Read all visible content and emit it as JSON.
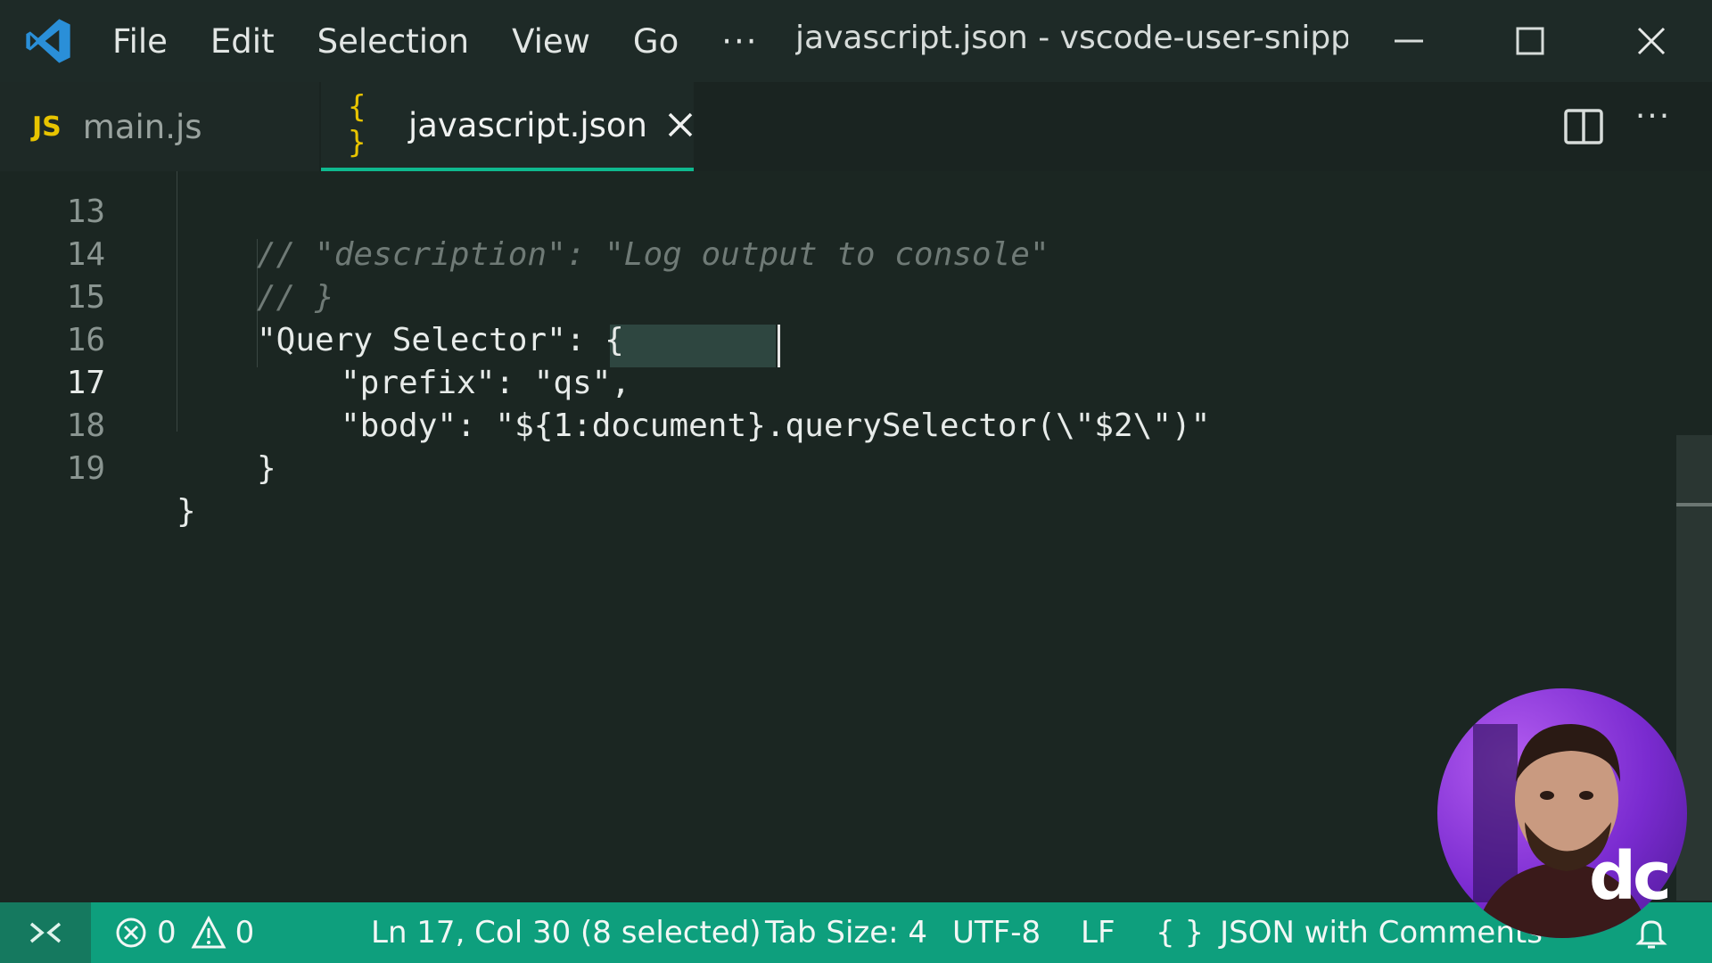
{
  "titlebar": {
    "menu": [
      "File",
      "Edit",
      "Selection",
      "View",
      "Go"
    ],
    "more_label": "···",
    "window_title": "javascript.json - vscode-user-snippet..."
  },
  "tabs": [
    {
      "badge": "JS",
      "label": "main.js",
      "active": false
    },
    {
      "badge": "{ }",
      "label": "javascript.json",
      "active": true
    }
  ],
  "editor_actions": {
    "more_label": "···"
  },
  "editor": {
    "lines": [
      {
        "number": "13",
        "text": "// \"description\": \"Log output to console\""
      },
      {
        "number": "14",
        "text": "// }"
      },
      {
        "number": "15",
        "text": "\"Query Selector\": {"
      },
      {
        "number": "16",
        "text": "\"prefix\": \"qs\","
      },
      {
        "number": "17",
        "before_selection": "\"body\": \"${1:",
        "selection": "document",
        "after_selection": "}.querySelector(\\\"$2\\\")\""
      },
      {
        "number": "18",
        "text": "}"
      },
      {
        "number": "19",
        "text": "}"
      }
    ],
    "active_line": "17"
  },
  "statusbar": {
    "errors": "0",
    "warnings": "0",
    "position": "Ln 17, Col 30 (8 selected)",
    "tab_size": "Tab Size: 4",
    "encoding": "UTF-8",
    "eol": "LF",
    "language_braces": "{ }",
    "language": "JSON with Comments"
  },
  "webcam": {
    "logo": "dc"
  },
  "colors": {
    "accent": "#0fb98f",
    "statusbar": "#0e9f7d",
    "js_badge": "#e8c400",
    "editor_bg": "#1b2622"
  },
  "icons": [
    "vscode-logo-icon",
    "minimize-icon",
    "maximize-icon",
    "close-icon",
    "tab-close-icon",
    "split-editor-icon",
    "remote-icon",
    "error-icon",
    "warning-icon",
    "bell-icon"
  ]
}
